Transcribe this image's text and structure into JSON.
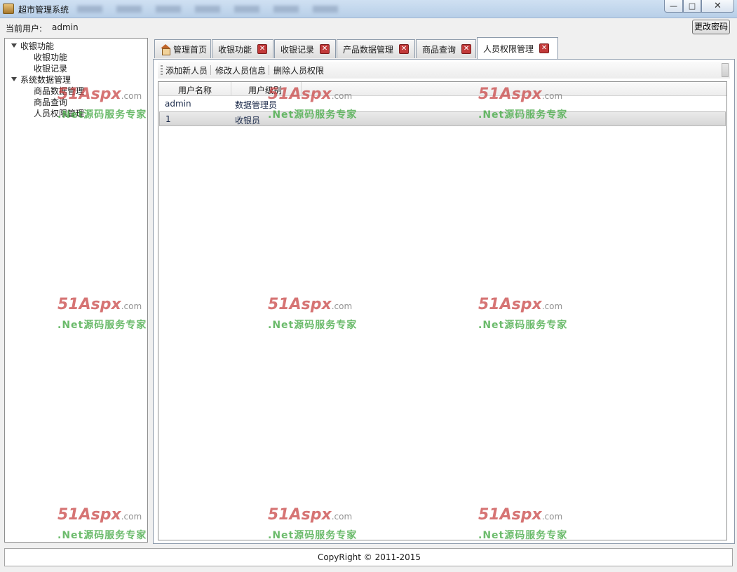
{
  "window": {
    "title": "超市管理系统",
    "controls": {
      "minimize": "—",
      "maximize": "□",
      "close": "✕"
    }
  },
  "userbar": {
    "current_user_label": "当前用户:",
    "current_user_name": "admin",
    "change_password_label": "更改密码"
  },
  "tree": {
    "groups": [
      {
        "label": "收银功能",
        "children": [
          "收银功能",
          "收银记录"
        ]
      },
      {
        "label": "系统数据管理",
        "children": [
          "商品数据管理",
          "商品查询",
          "人员权限管理"
        ]
      }
    ]
  },
  "tabs": [
    {
      "label": "管理首页",
      "closable": false,
      "icon": "home-icon"
    },
    {
      "label": "收银功能",
      "closable": true
    },
    {
      "label": "收银记录",
      "closable": true
    },
    {
      "label": "产品数据管理",
      "closable": true
    },
    {
      "label": "商品查询",
      "closable": true
    },
    {
      "label": "人员权限管理",
      "closable": true,
      "active": true
    }
  ],
  "toolbar": {
    "add_label": "添加新人员",
    "edit_label": "修改人员信息",
    "delete_label": "删除人员权限"
  },
  "grid": {
    "columns": [
      "用户名称",
      "用户级别"
    ],
    "rows": [
      {
        "name": "admin",
        "level": "数据管理员"
      },
      {
        "name": "1",
        "level": "收银员",
        "selected": true
      }
    ]
  },
  "statusbar": {
    "copyright": "CopyRight © 2011-2015"
  },
  "watermark": {
    "logo": "51Aspx",
    "domain": ".com",
    "tagline": ".Net源码服务专家"
  },
  "colors": {
    "tab_close": "#c23a3a",
    "watermark_logo": "#c84646",
    "watermark_tagline": "#46aa46"
  }
}
